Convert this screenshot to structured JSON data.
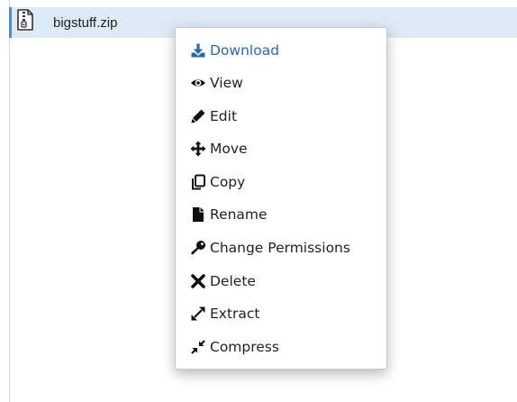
{
  "file": {
    "name": "bigstuff.zip",
    "icon": "zip-file-icon"
  },
  "colors": {
    "row_highlight": "#dceaf5",
    "row_accent": "#4a90c8",
    "active_item": "#2a6aa8",
    "text": "#222222"
  },
  "context_menu": {
    "items": [
      {
        "label": "Download",
        "icon": "download-icon"
      },
      {
        "label": "View",
        "icon": "eye-icon"
      },
      {
        "label": "Edit",
        "icon": "pencil-icon"
      },
      {
        "label": "Move",
        "icon": "move-arrows-icon"
      },
      {
        "label": "Copy",
        "icon": "copy-icon"
      },
      {
        "label": "Rename",
        "icon": "file-icon"
      },
      {
        "label": "Change Permissions",
        "icon": "key-icon"
      },
      {
        "label": "Delete",
        "icon": "x-icon"
      },
      {
        "label": "Extract",
        "icon": "expand-icon"
      },
      {
        "label": "Compress",
        "icon": "compress-icon"
      }
    ]
  }
}
